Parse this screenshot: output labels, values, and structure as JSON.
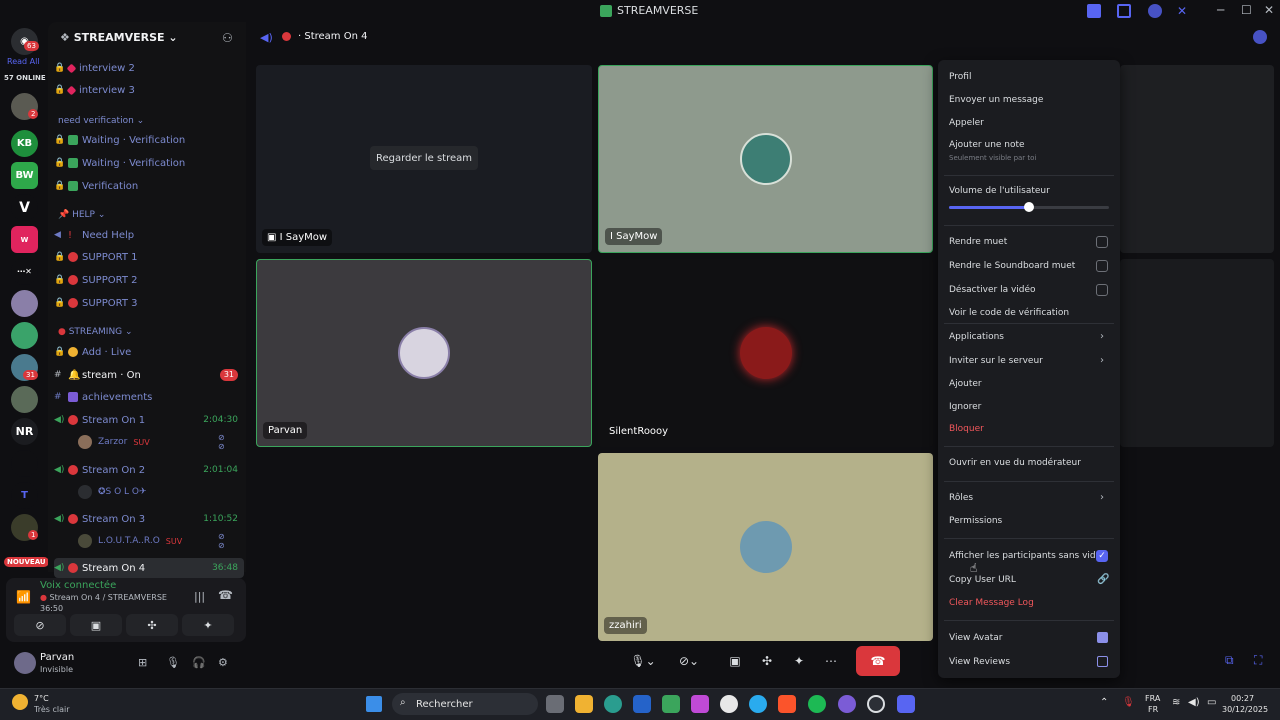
{
  "app": {
    "title": "STREAMVERSE"
  },
  "rail": {
    "badge_top": "63",
    "read_all": "Read All",
    "online": "57 ONLINE",
    "new_label": "NOUVEAU",
    "nr": "NR",
    "badge_2": "2",
    "badge_31": "31",
    "badge_1": "1"
  },
  "sidebar": {
    "server_name": "STREAMVERSE",
    "channels": [
      {
        "label": "interview 2"
      },
      {
        "label": "interview 3"
      }
    ],
    "cat_verification": "need verification",
    "verif": [
      {
        "label": "Waiting · Verification"
      },
      {
        "label": "Waiting · Verification"
      },
      {
        "label": "Verification"
      }
    ],
    "cat_help": "HELP",
    "help": [
      {
        "label": "Need Help"
      },
      {
        "label": "SUPPORT 1"
      },
      {
        "label": "SUPPORT 2"
      },
      {
        "label": "SUPPORT 3"
      }
    ],
    "cat_streaming": "STREAMING",
    "streaming_text": [
      {
        "label": "Add · Live"
      },
      {
        "label": "stream · On",
        "badge": "31"
      },
      {
        "label": "achievements"
      }
    ],
    "voice_channels": [
      {
        "label": "Stream On 1",
        "time": "2:04:30",
        "member": "Zarzor",
        "tag": "SUV"
      },
      {
        "label": "Stream On 2",
        "time": "2:01:04",
        "member": "✪S O L O✈"
      },
      {
        "label": "Stream On 3",
        "time": "1:10:52",
        "member": "L.O.U.T.A..R.O",
        "tag": "SUV"
      },
      {
        "label": "Stream On 4",
        "time": "36:48"
      }
    ]
  },
  "voice_panel": {
    "status": "Voix connectée",
    "channel": "Stream On 4 / STREAMVERSE",
    "elapsed": "36:50"
  },
  "user": {
    "name": "Parvan",
    "status": "Invisible"
  },
  "main": {
    "channel_title": "Stream On 4",
    "watch_button": "Regarder le stream",
    "tiles": [
      {
        "name": "I SayMow"
      },
      {
        "name": "I SayMow"
      },
      {
        "name": "Parvan"
      },
      {
        "name": "SilentRoooy"
      },
      {
        "name": "zzahiri"
      }
    ]
  },
  "menu": {
    "profil": "Profil",
    "send_message": "Envoyer un message",
    "call": "Appeler",
    "add_note": "Ajouter une note",
    "note_hint": "Seulement visible par toi",
    "volume_label": "Volume de l'utilisateur",
    "volume_value": 0.5,
    "mute": "Rendre muet",
    "mute_soundboard": "Rendre le Soundboard muet",
    "disable_video": "Désactiver la vidéo",
    "verify_code": "Voir le code de vérification",
    "applications": "Applications",
    "invite": "Inviter sur le serveur",
    "add": "Ajouter",
    "ignore": "Ignorer",
    "block": "Bloquer",
    "mod_view": "Ouvrir en vue du modérateur",
    "roles": "Rôles",
    "permissions": "Permissions",
    "show_no_video": "Afficher les participants sans vidéo",
    "show_no_video_checked": true,
    "copy_url": "Copy User URL",
    "clear_log": "Clear Message Log",
    "view_avatar": "View Avatar",
    "view_reviews": "View Reviews"
  },
  "taskbar": {
    "weather_temp": "7°C",
    "weather_desc": "Très clair",
    "search_placeholder": "Rechercher",
    "lang_top": "FRA",
    "lang_bottom": "FR",
    "time": "00:27",
    "date": "30/12/2025"
  },
  "colors": {
    "accent": "#5865f2",
    "danger": "#da373c",
    "online": "#3ba55c",
    "channel": "#7d8bd0"
  }
}
